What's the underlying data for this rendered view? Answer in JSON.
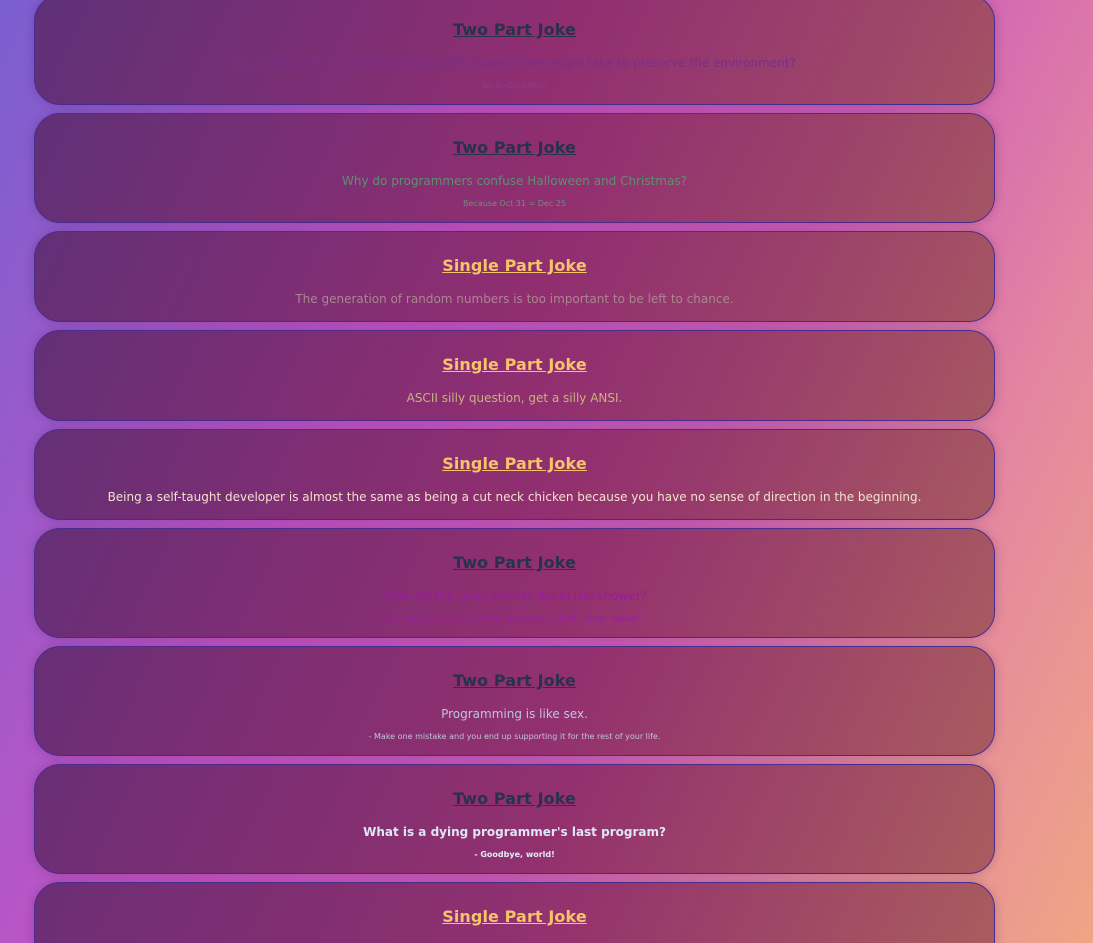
{
  "jokes": [
    {
      "type_label": "Two Part Joke",
      "setup": "So what's a set of predefined steps the government might take to preserve the environment?",
      "delivery": "An Al-Gore-ithm",
      "setup_color": "#7a2f86",
      "delivery_color": "#8a3f8c"
    },
    {
      "type_label": "Two Part Joke",
      "setup": "Why do programmers confuse Halloween and Christmas?",
      "delivery": "Because Oct 31 = Dec 25",
      "setup_color": "#5f8e70",
      "delivery_color": "#6b8f78"
    },
    {
      "type_label": "Single Part Joke",
      "joke": "The generation of random numbers is too important to be left to chance.",
      "joke_color": "#a98690"
    },
    {
      "type_label": "Single Part Joke",
      "joke": "ASCII silly question, get a silly ANSI.",
      "joke_color": "#c9b27e"
    },
    {
      "type_label": "Single Part Joke",
      "joke": "Being a self-taught developer is almost the same as being a cut neck chicken because you have no sense of direction in the beginning.",
      "joke_color": "#f2e2cc"
    },
    {
      "type_label": "Two Part Joke",
      "setup": "How did the programmer die in the shower?",
      "delivery": "He read the shampoo bottle instructions: Lather. Rinse. Repeat.",
      "setup_color": "#9b1aa0",
      "delivery_color": "#9a1e9e"
    },
    {
      "type_label": "Two Part Joke",
      "setup": "Programming is like sex.",
      "delivery": "- Make one mistake and you end up supporting it for the rest of your life.",
      "setup_color": "#b9c7d8",
      "delivery_color": "#bcc6d4"
    },
    {
      "type_label": "Two Part Joke",
      "setup": "What is a dying programmer's last program?",
      "delivery": "- Goodbye, world!",
      "setup_color": "#dde6f4",
      "delivery_color": "#e4ebf6"
    },
    {
      "type_label": "Single Part Joke",
      "joke": "",
      "joke_color": "#f2e2cc"
    }
  ]
}
